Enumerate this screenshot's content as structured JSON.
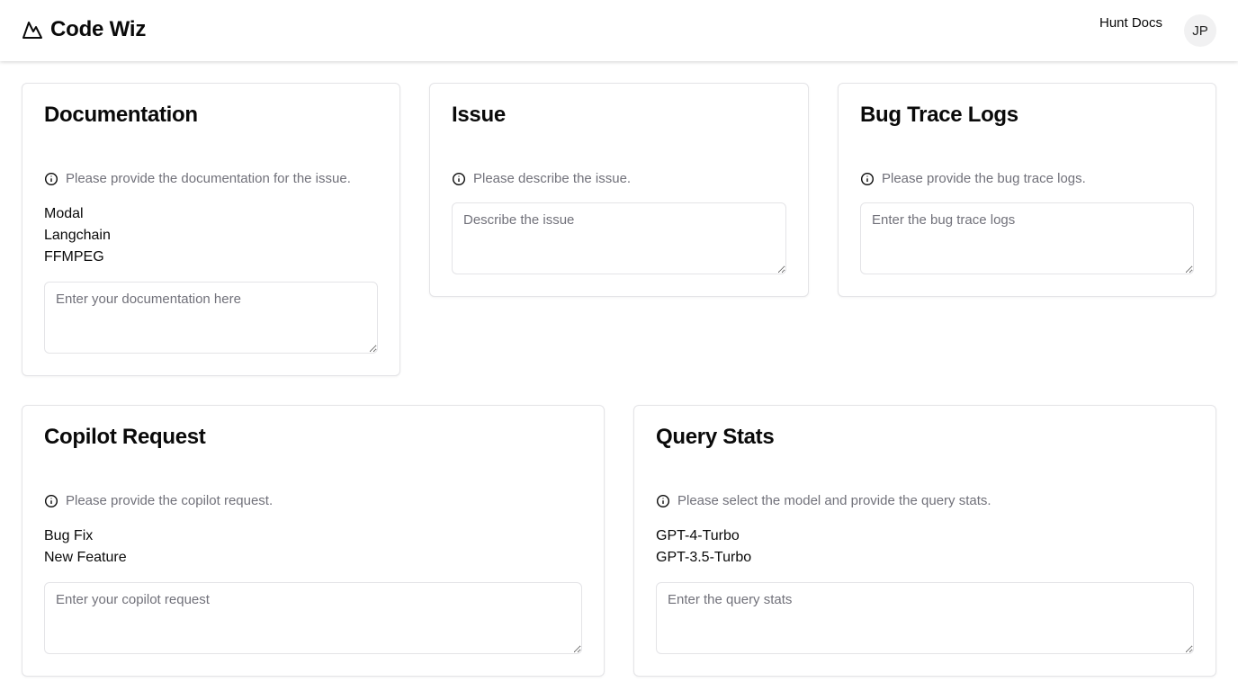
{
  "header": {
    "app_name": "Code Wiz",
    "logo_icon": "mountain-icon",
    "nav_link": "Hunt Docs",
    "avatar_initials": "JP"
  },
  "cards": {
    "documentation": {
      "title": "Documentation",
      "hint": "Please provide the documentation for the issue.",
      "options": [
        "Modal",
        "Langchain",
        "FFMPEG"
      ],
      "placeholder": "Enter your documentation here"
    },
    "issue": {
      "title": "Issue",
      "hint": "Please describe the issue.",
      "placeholder": "Describe the issue"
    },
    "bug_trace": {
      "title": "Bug Trace Logs",
      "hint": "Please provide the bug trace logs.",
      "placeholder": "Enter the bug trace logs"
    },
    "copilot": {
      "title": "Copilot Request",
      "hint": "Please provide the copilot request.",
      "options": [
        "Bug Fix",
        "New Feature"
      ],
      "placeholder": "Enter your copilot request"
    },
    "query_stats": {
      "title": "Query Stats",
      "hint": "Please select the model and provide the query stats.",
      "options": [
        "GPT-4-Turbo",
        "GPT-3.5-Turbo"
      ],
      "placeholder": "Enter the query stats"
    }
  },
  "icons": {
    "hint": "info-icon"
  },
  "colors": {
    "muted_text": "#71717a",
    "border": "#e4e4e7",
    "avatar_bg": "#f1f1f2"
  }
}
